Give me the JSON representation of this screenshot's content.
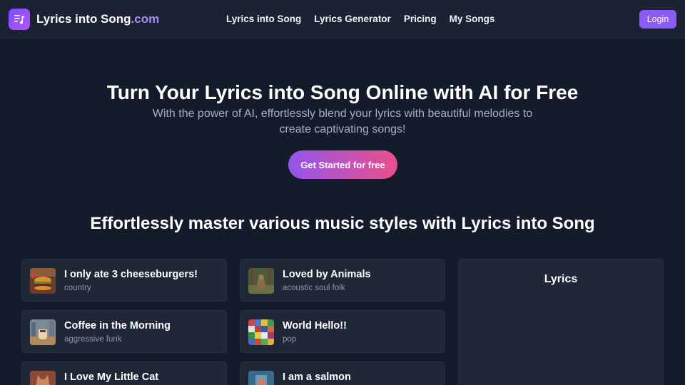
{
  "brand": {
    "name_main": "Lyrics into Song",
    "name_tld": ".com",
    "logo_icon": "music-note-list-icon"
  },
  "nav": {
    "links": [
      "Lyrics into Song",
      "Lyrics Generator",
      "Pricing",
      "My Songs"
    ],
    "login_label": "Login"
  },
  "hero": {
    "title": "Turn Your Lyrics into Song Online with AI for Free",
    "subtitle": "With the power of AI, effortlessly blend your lyrics with beautiful melodies to create captivating songs!",
    "cta_label": "Get Started for free"
  },
  "styles_section": {
    "title": "Effortlessly master various music styles with Lyrics into Song"
  },
  "songs": [
    {
      "title": "I only ate 3 cheeseburgers!",
      "genre": "country"
    },
    {
      "title": "Loved by Animals",
      "genre": "acoustic soul folk"
    },
    {
      "title": "Coffee in the Morning",
      "genre": "aggressive funk"
    },
    {
      "title": "World Hello!!",
      "genre": "pop"
    },
    {
      "title": "I Love My Little Cat",
      "genre": ""
    },
    {
      "title": "I am a salmon",
      "genre": ""
    }
  ],
  "lyrics_panel": {
    "title": "Lyrics"
  },
  "colors": {
    "background": "#141b2a",
    "nav": "#1b2233",
    "accent": "#8b5cf6",
    "cta_gradient_start": "#9455ec",
    "cta_gradient_end": "#e9508a"
  }
}
